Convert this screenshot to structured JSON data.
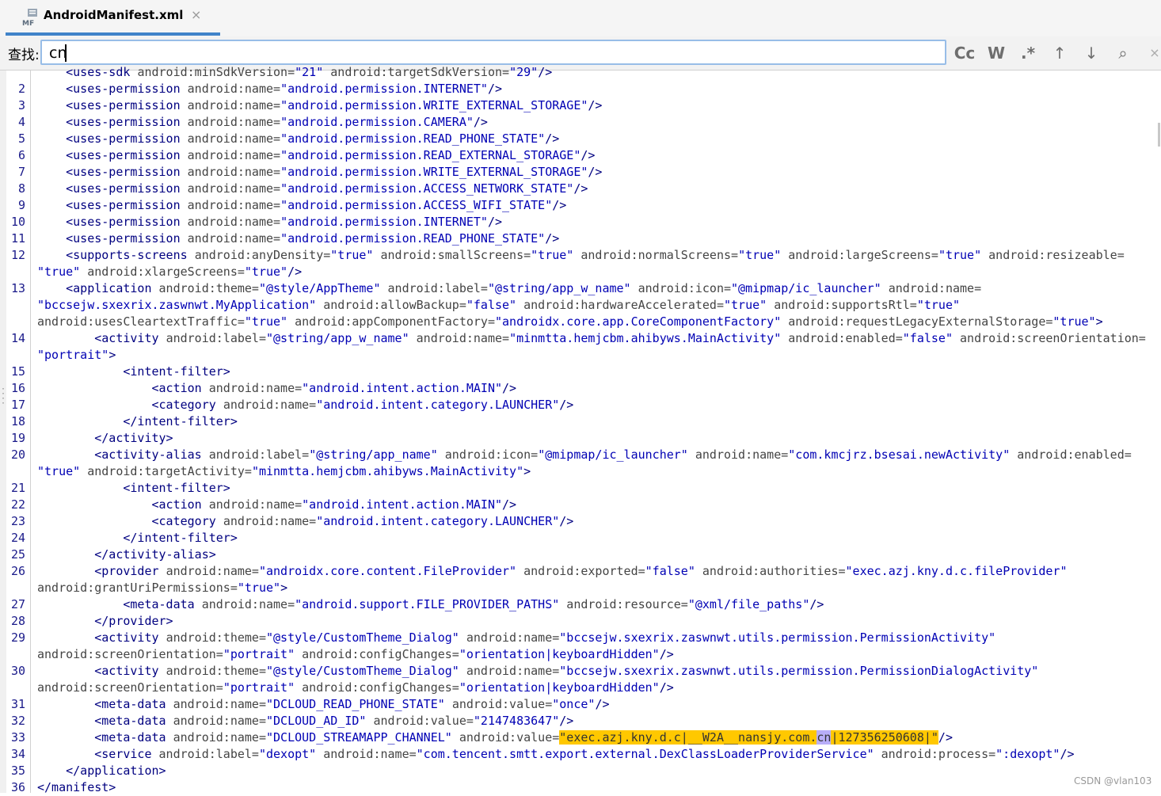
{
  "tab": {
    "title": "AndroidManifest.xml",
    "icon": "MF",
    "close": "×"
  },
  "find": {
    "label": "查找:",
    "value": "cn",
    "buttons": {
      "match_case": "Cc",
      "words": "W",
      "regex": ".*",
      "prev": "↑",
      "next": "↓",
      "find_all": "⌕",
      "close": "×"
    }
  },
  "watermark": "CSDN @vlan103",
  "line_numbers": [
    "2",
    "3",
    "4",
    "5",
    "6",
    "7",
    "8",
    "9",
    "10",
    "11",
    "12",
    "13",
    "14",
    "15",
    "16",
    "17",
    "18",
    "19",
    "20",
    "21",
    "22",
    "23",
    "24",
    "25",
    "26",
    "27",
    "28",
    "29",
    "30",
    "31",
    "32",
    "33",
    "34",
    "35",
    "36"
  ],
  "code": [
    {
      "ln": "",
      "parts": [
        [
          "t",
          "    <uses-sdk "
        ],
        [
          "a",
          "android:minSdkVersion="
        ],
        [
          "v",
          "\"21\" "
        ],
        [
          "a",
          "android:targetSdkVersion="
        ],
        [
          "v",
          "\"29\""
        ],
        [
          "t",
          "/>"
        ]
      ]
    },
    {
      "ln": "2",
      "parts": [
        [
          "t",
          "    <uses-permission "
        ],
        [
          "a",
          "android:name="
        ],
        [
          "v",
          "\"android.permission.INTERNET\""
        ],
        [
          "t",
          "/>"
        ]
      ]
    },
    {
      "ln": "3",
      "parts": [
        [
          "t",
          "    <uses-permission "
        ],
        [
          "a",
          "android:name="
        ],
        [
          "v",
          "\"android.permission.WRITE_EXTERNAL_STORAGE\""
        ],
        [
          "t",
          "/>"
        ]
      ]
    },
    {
      "ln": "4",
      "parts": [
        [
          "t",
          "    <uses-permission "
        ],
        [
          "a",
          "android:name="
        ],
        [
          "v",
          "\"android.permission.CAMERA\""
        ],
        [
          "t",
          "/>"
        ]
      ]
    },
    {
      "ln": "5",
      "parts": [
        [
          "t",
          "    <uses-permission "
        ],
        [
          "a",
          "android:name="
        ],
        [
          "v",
          "\"android.permission.READ_PHONE_STATE\""
        ],
        [
          "t",
          "/>"
        ]
      ]
    },
    {
      "ln": "6",
      "parts": [
        [
          "t",
          "    <uses-permission "
        ],
        [
          "a",
          "android:name="
        ],
        [
          "v",
          "\"android.permission.READ_EXTERNAL_STORAGE\""
        ],
        [
          "t",
          "/>"
        ]
      ]
    },
    {
      "ln": "7",
      "parts": [
        [
          "t",
          "    <uses-permission "
        ],
        [
          "a",
          "android:name="
        ],
        [
          "v",
          "\"android.permission.WRITE_EXTERNAL_STORAGE\""
        ],
        [
          "t",
          "/>"
        ]
      ]
    },
    {
      "ln": "8",
      "parts": [
        [
          "t",
          "    <uses-permission "
        ],
        [
          "a",
          "android:name="
        ],
        [
          "v",
          "\"android.permission.ACCESS_NETWORK_STATE\""
        ],
        [
          "t",
          "/>"
        ]
      ]
    },
    {
      "ln": "9",
      "parts": [
        [
          "t",
          "    <uses-permission "
        ],
        [
          "a",
          "android:name="
        ],
        [
          "v",
          "\"android.permission.ACCESS_WIFI_STATE\""
        ],
        [
          "t",
          "/>"
        ]
      ]
    },
    {
      "ln": "10",
      "parts": [
        [
          "t",
          "    <uses-permission "
        ],
        [
          "a",
          "android:name="
        ],
        [
          "v",
          "\"android.permission.INTERNET\""
        ],
        [
          "t",
          "/>"
        ]
      ]
    },
    {
      "ln": "11",
      "parts": [
        [
          "t",
          "    <uses-permission "
        ],
        [
          "a",
          "android:name="
        ],
        [
          "v",
          "\"android.permission.READ_PHONE_STATE\""
        ],
        [
          "t",
          "/>"
        ]
      ]
    },
    {
      "ln": "12",
      "parts": [
        [
          "t",
          "    <supports-screens "
        ],
        [
          "a",
          "android:anyDensity="
        ],
        [
          "v",
          "\"true\" "
        ],
        [
          "a",
          "android:smallScreens="
        ],
        [
          "v",
          "\"true\" "
        ],
        [
          "a",
          "android:normalScreens="
        ],
        [
          "v",
          "\"true\" "
        ],
        [
          "a",
          "android:largeScreens="
        ],
        [
          "v",
          "\"true\" "
        ],
        [
          "a",
          "android:resizeable="
        ]
      ]
    },
    {
      "ln": "",
      "parts": [
        [
          "v",
          "\"true\" "
        ],
        [
          "a",
          "android:xlargeScreens="
        ],
        [
          "v",
          "\"true\""
        ],
        [
          "t",
          "/>"
        ]
      ]
    },
    {
      "ln": "13",
      "parts": [
        [
          "t",
          "    <application "
        ],
        [
          "a",
          "android:theme="
        ],
        [
          "v",
          "\"@style/AppTheme\" "
        ],
        [
          "a",
          "android:label="
        ],
        [
          "v",
          "\"@string/app_w_name\" "
        ],
        [
          "a",
          "android:icon="
        ],
        [
          "v",
          "\"@mipmap/ic_launcher\" "
        ],
        [
          "a",
          "android:name="
        ]
      ]
    },
    {
      "ln": "",
      "parts": [
        [
          "v",
          "\"bccsejw.sxexrix.zaswnwt.MyApplication\" "
        ],
        [
          "a",
          "android:allowBackup="
        ],
        [
          "v",
          "\"false\" "
        ],
        [
          "a",
          "android:hardwareAccelerated="
        ],
        [
          "v",
          "\"true\" "
        ],
        [
          "a",
          "android:supportsRtl="
        ],
        [
          "v",
          "\"true\""
        ]
      ]
    },
    {
      "ln": "",
      "parts": [
        [
          "a",
          "android:usesCleartextTraffic="
        ],
        [
          "v",
          "\"true\" "
        ],
        [
          "a",
          "android:appComponentFactory="
        ],
        [
          "v",
          "\"androidx.core.app.CoreComponentFactory\" "
        ],
        [
          "a",
          "android:requestLegacyExternalStorage="
        ],
        [
          "v",
          "\"true\""
        ],
        [
          "t",
          ">"
        ]
      ]
    },
    {
      "ln": "14",
      "parts": [
        [
          "t",
          "        <activity "
        ],
        [
          "a",
          "android:label="
        ],
        [
          "v",
          "\"@string/app_w_name\" "
        ],
        [
          "a",
          "android:name="
        ],
        [
          "v",
          "\"minmtta.hemjcbm.ahibyws.MainActivity\" "
        ],
        [
          "a",
          "android:enabled="
        ],
        [
          "v",
          "\"false\" "
        ],
        [
          "a",
          "android:screenOrientation="
        ]
      ]
    },
    {
      "ln": "",
      "parts": [
        [
          "v",
          "\"portrait\""
        ],
        [
          "t",
          ">"
        ]
      ]
    },
    {
      "ln": "15",
      "parts": [
        [
          "t",
          "            <intent-filter>"
        ]
      ]
    },
    {
      "ln": "16",
      "parts": [
        [
          "t",
          "                <action "
        ],
        [
          "a",
          "android:name="
        ],
        [
          "v",
          "\"android.intent.action.MAIN\""
        ],
        [
          "t",
          "/>"
        ]
      ]
    },
    {
      "ln": "17",
      "parts": [
        [
          "t",
          "                <category "
        ],
        [
          "a",
          "android:name="
        ],
        [
          "v",
          "\"android.intent.category.LAUNCHER\""
        ],
        [
          "t",
          "/>"
        ]
      ]
    },
    {
      "ln": "18",
      "parts": [
        [
          "t",
          "            </intent-filter>"
        ]
      ]
    },
    {
      "ln": "19",
      "parts": [
        [
          "t",
          "        </activity>"
        ]
      ]
    },
    {
      "ln": "20",
      "parts": [
        [
          "t",
          "        <activity-alias "
        ],
        [
          "a",
          "android:label="
        ],
        [
          "v",
          "\"@string/app_name\" "
        ],
        [
          "a",
          "android:icon="
        ],
        [
          "v",
          "\"@mipmap/ic_launcher\" "
        ],
        [
          "a",
          "android:name="
        ],
        [
          "v",
          "\"com.kmcjrz.bsesai.newActivity\" "
        ],
        [
          "a",
          "android:enabled="
        ]
      ]
    },
    {
      "ln": "",
      "parts": [
        [
          "v",
          "\"true\" "
        ],
        [
          "a",
          "android:targetActivity="
        ],
        [
          "v",
          "\"minmtta.hemjcbm.ahibyws.MainActivity\""
        ],
        [
          "t",
          ">"
        ]
      ]
    },
    {
      "ln": "21",
      "parts": [
        [
          "t",
          "            <intent-filter>"
        ]
      ]
    },
    {
      "ln": "22",
      "parts": [
        [
          "t",
          "                <action "
        ],
        [
          "a",
          "android:name="
        ],
        [
          "v",
          "\"android.intent.action.MAIN\""
        ],
        [
          "t",
          "/>"
        ]
      ]
    },
    {
      "ln": "23",
      "parts": [
        [
          "t",
          "                <category "
        ],
        [
          "a",
          "android:name="
        ],
        [
          "v",
          "\"android.intent.category.LAUNCHER\""
        ],
        [
          "t",
          "/>"
        ]
      ]
    },
    {
      "ln": "24",
      "parts": [
        [
          "t",
          "            </intent-filter>"
        ]
      ]
    },
    {
      "ln": "25",
      "parts": [
        [
          "t",
          "        </activity-alias>"
        ]
      ]
    },
    {
      "ln": "26",
      "parts": [
        [
          "t",
          "        <provider "
        ],
        [
          "a",
          "android:name="
        ],
        [
          "v",
          "\"androidx.core.content.FileProvider\" "
        ],
        [
          "a",
          "android:exported="
        ],
        [
          "v",
          "\"false\" "
        ],
        [
          "a",
          "android:authorities="
        ],
        [
          "v",
          "\"exec.azj.kny.d.c.fileProvider\""
        ]
      ]
    },
    {
      "ln": "",
      "parts": [
        [
          "a",
          "android:grantUriPermissions="
        ],
        [
          "v",
          "\"true\""
        ],
        [
          "t",
          ">"
        ]
      ]
    },
    {
      "ln": "27",
      "parts": [
        [
          "t",
          "            <meta-data "
        ],
        [
          "a",
          "android:name="
        ],
        [
          "v",
          "\"android.support.FILE_PROVIDER_PATHS\" "
        ],
        [
          "a",
          "android:resource="
        ],
        [
          "v",
          "\"@xml/file_paths\""
        ],
        [
          "t",
          "/>"
        ]
      ]
    },
    {
      "ln": "28",
      "parts": [
        [
          "t",
          "        </provider>"
        ]
      ]
    },
    {
      "ln": "29",
      "parts": [
        [
          "t",
          "        <activity "
        ],
        [
          "a",
          "android:theme="
        ],
        [
          "v",
          "\"@style/CustomTheme_Dialog\" "
        ],
        [
          "a",
          "android:name="
        ],
        [
          "v",
          "\"bccsejw.sxexrix.zaswnwt.utils.permission.PermissionActivity\""
        ]
      ]
    },
    {
      "ln": "",
      "parts": [
        [
          "a",
          "android:screenOrientation="
        ],
        [
          "v",
          "\"portrait\" "
        ],
        [
          "a",
          "android:configChanges="
        ],
        [
          "v",
          "\"orientation|keyboardHidden\""
        ],
        [
          "t",
          "/>"
        ]
      ]
    },
    {
      "ln": "30",
      "parts": [
        [
          "t",
          "        <activity "
        ],
        [
          "a",
          "android:theme="
        ],
        [
          "v",
          "\"@style/CustomTheme_Dialog\" "
        ],
        [
          "a",
          "android:name="
        ],
        [
          "v",
          "\"bccsejw.sxexrix.zaswnwt.utils.permission.PermissionDialogActivity\""
        ]
      ]
    },
    {
      "ln": "",
      "parts": [
        [
          "a",
          "android:screenOrientation="
        ],
        [
          "v",
          "\"portrait\" "
        ],
        [
          "a",
          "android:configChanges="
        ],
        [
          "v",
          "\"orientation|keyboardHidden\""
        ],
        [
          "t",
          "/>"
        ]
      ]
    },
    {
      "ln": "31",
      "parts": [
        [
          "t",
          "        <meta-data "
        ],
        [
          "a",
          "android:name="
        ],
        [
          "v",
          "\"DCLOUD_READ_PHONE_STATE\" "
        ],
        [
          "a",
          "android:value="
        ],
        [
          "v",
          "\"once\""
        ],
        [
          "t",
          "/>"
        ]
      ]
    },
    {
      "ln": "32",
      "parts": [
        [
          "t",
          "        <meta-data "
        ],
        [
          "a",
          "android:name="
        ],
        [
          "v",
          "\"DCLOUD_AD_ID\" "
        ],
        [
          "a",
          "android:value="
        ],
        [
          "v",
          "\"2147483647\""
        ],
        [
          "t",
          "/>"
        ]
      ]
    },
    {
      "ln": "33",
      "parts": [
        [
          "t",
          "        <meta-data "
        ],
        [
          "a",
          "android:name="
        ],
        [
          "v",
          "\"DCLOUD_STREAMAPP_CHANNEL\" "
        ],
        [
          "a",
          "android:value="
        ],
        [
          "hl",
          "\"exec.azj.kny.d.c|__W2A__nansjy.com."
        ],
        [
          "hm",
          "cn"
        ],
        [
          "hl",
          "|127356250608|\""
        ],
        [
          "t",
          "/>"
        ]
      ]
    },
    {
      "ln": "34",
      "parts": [
        [
          "t",
          "        <service "
        ],
        [
          "a",
          "android:label="
        ],
        [
          "v",
          "\"dexopt\" "
        ],
        [
          "a",
          "android:name="
        ],
        [
          "v",
          "\"com.tencent.smtt.export.external.DexClassLoaderProviderService\" "
        ],
        [
          "a",
          "android:process="
        ],
        [
          "v",
          "\":dexopt\""
        ],
        [
          "t",
          "/>"
        ]
      ]
    },
    {
      "ln": "35",
      "parts": [
        [
          "t",
          "    </application>"
        ]
      ]
    },
    {
      "ln": "36",
      "parts": [
        [
          "t",
          "</manifest>"
        ]
      ]
    }
  ]
}
